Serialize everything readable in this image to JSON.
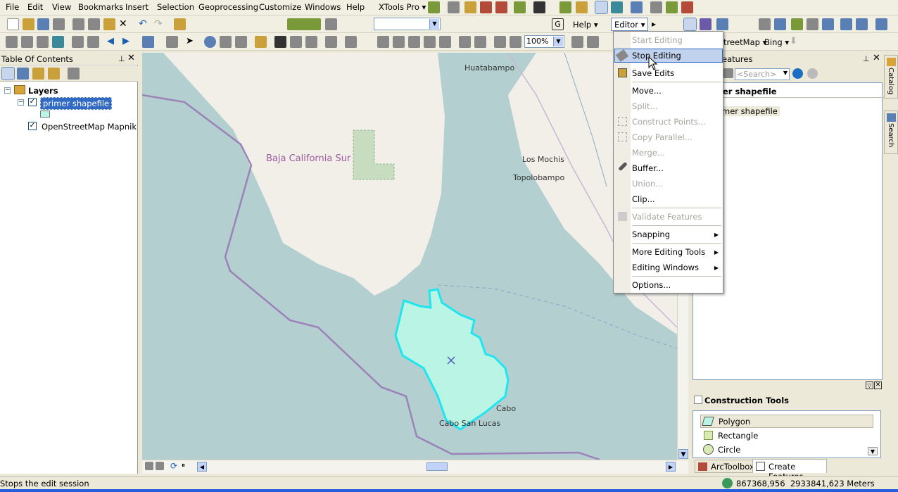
{
  "menubar": {
    "items": [
      "File",
      "Edit",
      "View",
      "Bookmarks",
      "Insert",
      "Selection",
      "Geoprocessing",
      "Customize",
      "Windows",
      "Help"
    ],
    "xtools": "XTools Pro"
  },
  "toolbar2": {
    "help_label": "Help",
    "editor_label": "Editor"
  },
  "toolbar3": {
    "zoom_value": "100%",
    "basemap_label": "treetMap",
    "bing_label": "Bing"
  },
  "toc": {
    "title": "Table Of Contents",
    "root": "Layers",
    "layers": [
      {
        "label": "primer shapefile",
        "checked": true
      },
      {
        "label": "OpenStreetMap Mapnik",
        "checked": true
      }
    ]
  },
  "map": {
    "places": [
      "Huatabampo",
      "Baja California Sur",
      "Los Mochis",
      "Topolobampo",
      "Cabo",
      "Cabo San Lucas"
    ],
    "water_color": "#b4cfd0",
    "land_color": "#f2efe9",
    "polygon_color": "#b9f4e4",
    "polygon_stroke": "#1ee6f0"
  },
  "editor_menu": {
    "items": [
      {
        "label": "Start Editing",
        "disabled": true
      },
      {
        "label": "Stop Editing",
        "highlighted": true
      },
      {
        "label": "Save Edits"
      },
      {
        "label": "Move..."
      },
      {
        "label": "Split...",
        "disabled": true
      },
      {
        "label": "Construct Points...",
        "disabled": true
      },
      {
        "label": "Copy Parallel...",
        "disabled": true
      },
      {
        "label": "Merge...",
        "disabled": true
      },
      {
        "label": "Buffer..."
      },
      {
        "label": "Union...",
        "disabled": true
      },
      {
        "label": "Clip..."
      },
      {
        "label": "Validate Features",
        "disabled": true
      },
      {
        "label": "Snapping",
        "submenu": true
      },
      {
        "label": "More Editing Tools",
        "submenu": true
      },
      {
        "label": "Editing Windows",
        "submenu": true
      },
      {
        "label": "Options..."
      }
    ]
  },
  "create_features": {
    "title_partial": "eatures",
    "search_placeholder": "<Search>",
    "group_partial": "er shapefile",
    "template_partial": "mer shapefile"
  },
  "construction_tools": {
    "title": "Construction Tools",
    "tools": [
      "Polygon",
      "Rectangle",
      "Circle"
    ]
  },
  "bottom_tabs": {
    "arctoolbox": "ArcToolbox",
    "create_features": "Create Features"
  },
  "side_tabs": [
    "Catalog",
    "Search"
  ],
  "status": {
    "message": "Stops the edit session",
    "coords": "867368,956  2933841,623 Meters"
  }
}
